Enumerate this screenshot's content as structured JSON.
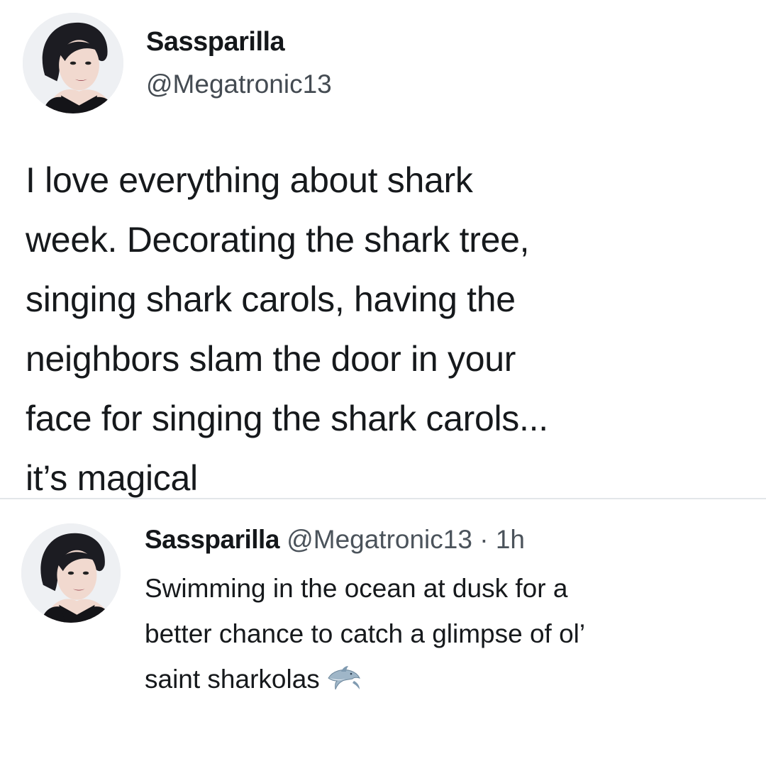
{
  "main_tweet": {
    "display_name": "Sassparilla",
    "handle": "@Megatronic13",
    "avatar_icon": "avatar-photo-icon",
    "text_lines": [
      "I love everything about shark",
      "week. Decorating the shark tree,",
      "singing shark carols, having the",
      "neighbors slam the door in your",
      "face for singing the shark carols...",
      "it’s magical"
    ]
  },
  "reply_tweet": {
    "display_name": "Sassparilla",
    "handle": "@Megatronic13",
    "separator": "·",
    "time": "1h",
    "avatar_icon": "avatar-photo-icon",
    "text_lines": [
      "Swimming in the ocean at dusk for a",
      "better chance to catch a glimpse of ol’",
      "saint sharkolas"
    ],
    "emoji_icon": "dolphin-icon"
  },
  "colors": {
    "background": "#ffffff",
    "text": "#14171a",
    "secondary_text": "#444b52",
    "divider": "#e3e6e9"
  }
}
